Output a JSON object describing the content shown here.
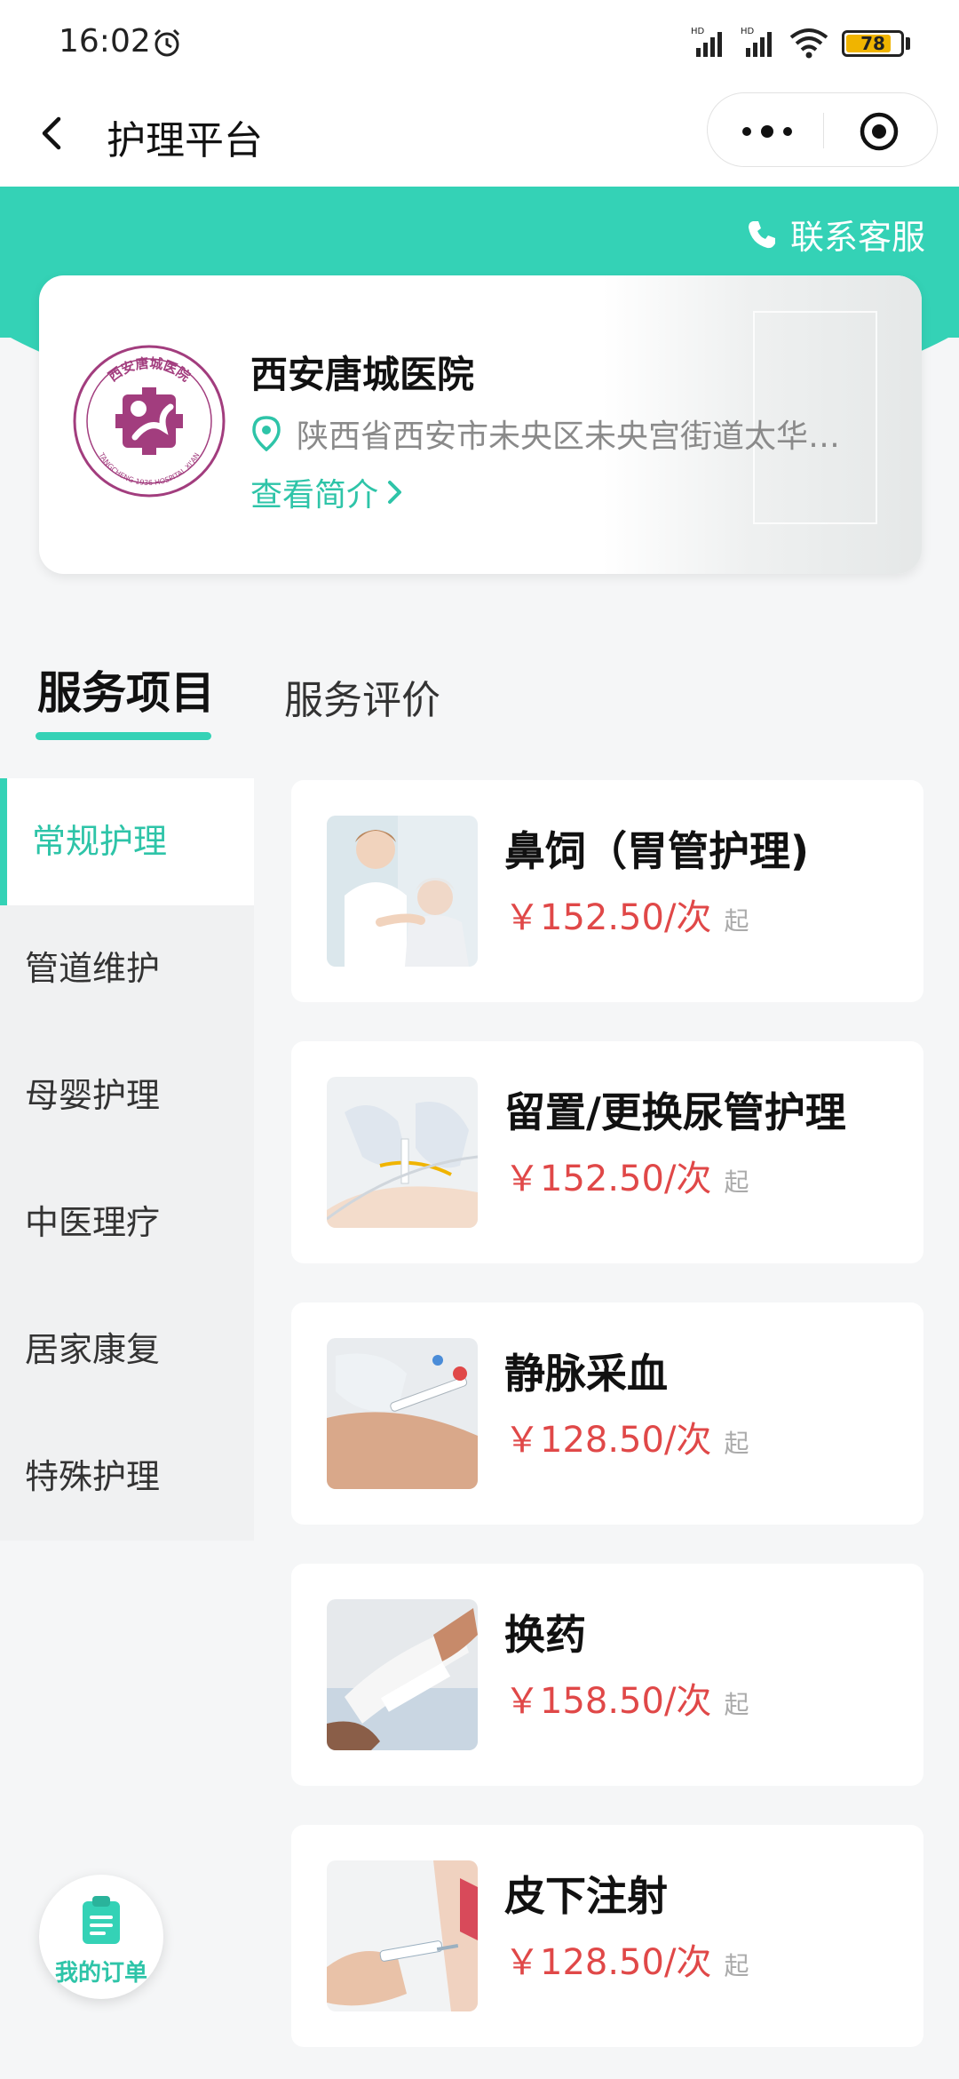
{
  "status_bar": {
    "time": "16:02",
    "signal_label_1": "HD",
    "signal_label_2": "HD",
    "battery": "78"
  },
  "nav": {
    "title": "护理平台"
  },
  "header": {
    "contact_label": "联系客服"
  },
  "hospital": {
    "name": "西安唐城医院",
    "address": "陕西省西安市未央区未央宫街道太华…",
    "intro_link": "查看简介",
    "logo_text": "西安唐城医院",
    "logo_subtext": "TANGCHENG 1936 HOSPITAL XI'AN"
  },
  "tabs": [
    {
      "label": "服务项目",
      "active": true
    },
    {
      "label": "服务评价",
      "active": false
    }
  ],
  "categories": [
    {
      "label": "常规护理",
      "active": true
    },
    {
      "label": "管道维护",
      "active": false
    },
    {
      "label": "母婴护理",
      "active": false
    },
    {
      "label": "中医理疗",
      "active": false
    },
    {
      "label": "居家康复",
      "active": false
    },
    {
      "label": "特殊护理",
      "active": false
    }
  ],
  "services": [
    {
      "title": "鼻饲（胃管护理)",
      "price": "￥152.50/次",
      "suffix": "起",
      "image": "nurse-with-elderly-patient"
    },
    {
      "title": "留置/更换尿管护理",
      "price": "￥152.50/次",
      "suffix": "起",
      "image": "gloved-hands-catheter"
    },
    {
      "title": "静脉采血",
      "price": "￥128.50/次",
      "suffix": "起",
      "image": "blood-draw-arm"
    },
    {
      "title": "换药",
      "price": "￥158.50/次",
      "suffix": "起",
      "image": "bandaged-arm"
    },
    {
      "title": "皮下注射",
      "price": "￥128.50/次",
      "suffix": "起",
      "image": "syringe-injection"
    }
  ],
  "order_button": {
    "label": "我的订单"
  },
  "colors": {
    "accent": "#34d2b6",
    "price": "#e04848",
    "logo": "#a23d7e"
  }
}
